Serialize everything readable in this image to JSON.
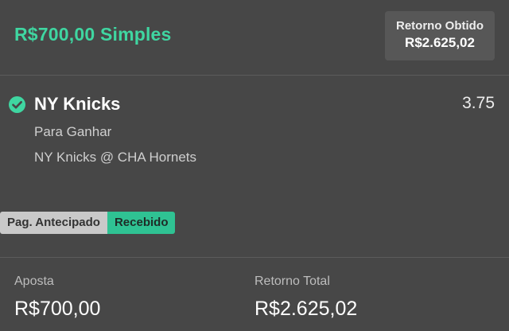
{
  "header": {
    "bet_title": "R$700,00 Simples",
    "return_label": "Retorno Obtido",
    "return_value": "R$2.625,02"
  },
  "selection": {
    "status_icon": "check-circle-icon",
    "team": "NY Knicks",
    "odds": "3.75",
    "market": "Para Ganhar",
    "event": "NY Knicks @ CHA Hornets"
  },
  "badges": {
    "early_payout": "Pag. Antecipado",
    "received": "Recebido"
  },
  "footer": {
    "stake_label": "Aposta",
    "stake_value": "R$700,00",
    "total_label": "Retorno Total",
    "total_value": "R$2.625,02"
  },
  "colors": {
    "accent": "#3fd6a1",
    "background": "#474747",
    "received_badge": "#2fc293",
    "early_badge": "#c9c9c9"
  }
}
